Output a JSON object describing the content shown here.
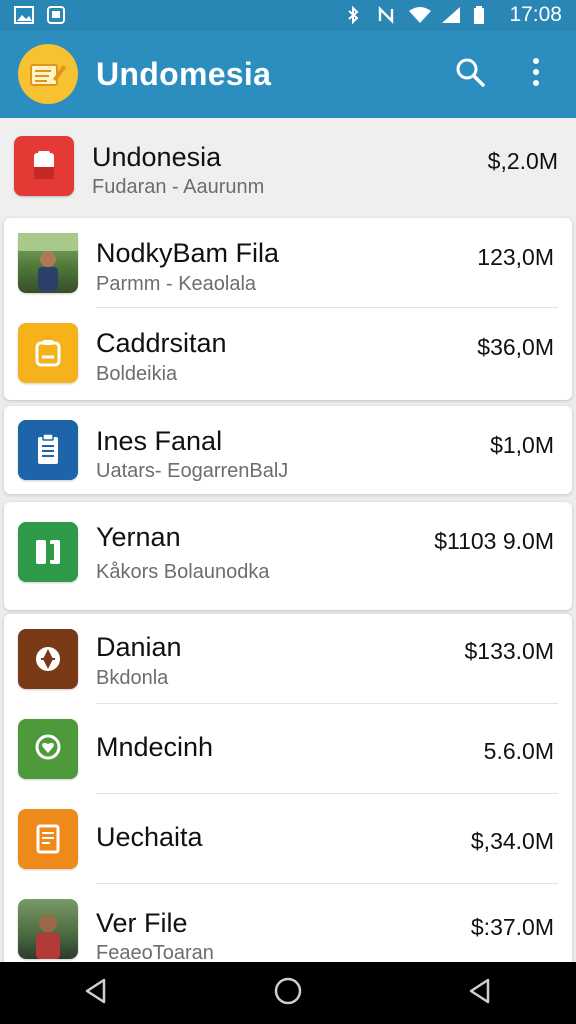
{
  "status_bar": {
    "time": "17:08",
    "icons": [
      "image-icon",
      "gallery-icon",
      "bluetooth-icon",
      "nfc-icon",
      "wifi-icon",
      "signal-icon",
      "battery-icon"
    ]
  },
  "app_bar": {
    "title": "Undomesia",
    "logo_icon": "folder-edit-icon",
    "actions": [
      "search-icon",
      "more-vert-icon"
    ],
    "colors": {
      "bar": "#2c8ebf",
      "logo": "#f6c232"
    }
  },
  "list": {
    "items": [
      {
        "title": "Undonesia",
        "subtitle": "Fudaran - Aaurunm",
        "price": "$,2.0M",
        "icon": "document-icon",
        "color": "#e53935"
      },
      {
        "title": "NodkyBam Fila",
        "subtitle": "Parmm - Keaolala",
        "price": "123,0M",
        "icon": "person-photo",
        "color": "#6a8a4a"
      },
      {
        "title": "Caddrsitan",
        "subtitle": "Boldeikia",
        "price": "$36,0M",
        "icon": "briefcase-icon",
        "color": "#f5b21b"
      },
      {
        "title": "Ines Fanal",
        "subtitle": "Uatars- EogarrenBalJ",
        "price": "$1,0M",
        "icon": "clipboard-icon",
        "color": "#1e64a8"
      },
      {
        "title": "Yernan",
        "subtitle": "Kåkors Bolaunodka",
        "price": "$1103 9.0M",
        "icon": "book-icon",
        "color": "#2e9a48"
      },
      {
        "title": "Danian",
        "subtitle": "Bkdonla",
        "price": "$133.0M",
        "icon": "badge-icon",
        "color": "#7b3a17"
      },
      {
        "title": "Mndecinh",
        "subtitle": "",
        "price": "5.6.0M",
        "icon": "heart-pin-icon",
        "color": "#4e9a3a"
      },
      {
        "title": "Uechaita",
        "subtitle": "",
        "price": "$,34.0M",
        "icon": "receipt-icon",
        "color": "#ee8a1a"
      },
      {
        "title": "Ver File",
        "subtitle": "FeaeoToaran",
        "price": "$:37.0M",
        "icon": "person-photo",
        "color": "#6e8a60"
      }
    ]
  },
  "nav_bar": {
    "buttons": [
      "back-icon",
      "home-icon",
      "recents-icon"
    ]
  }
}
